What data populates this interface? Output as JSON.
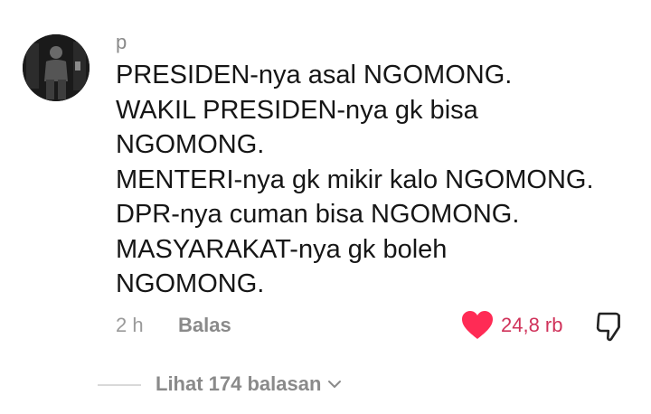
{
  "comment": {
    "username": "p",
    "lines": [
      "PRESIDEN-nya asal NGOMONG.",
      "WAKIL PRESIDEN-nya gk bisa",
      "NGOMONG.",
      "MENTERI-nya gk mikir kalo NGOMONG.",
      "DPR-nya cuman bisa NGOMONG.",
      "MASYARAKAT-nya gk boleh",
      "NGOMONG."
    ],
    "time": "2 h",
    "reply_label": "Balas",
    "like_count": "24,8 rb",
    "liked": true
  },
  "replies": {
    "view_label": "Lihat 174 balasan"
  },
  "icons": {
    "like": "heart-icon",
    "dislike": "thumbs-down-icon",
    "expand": "chevron-down-icon"
  },
  "colors": {
    "like_active": "#ff2b55",
    "like_count": "#d0325a",
    "muted_text": "#8a8a8a"
  }
}
